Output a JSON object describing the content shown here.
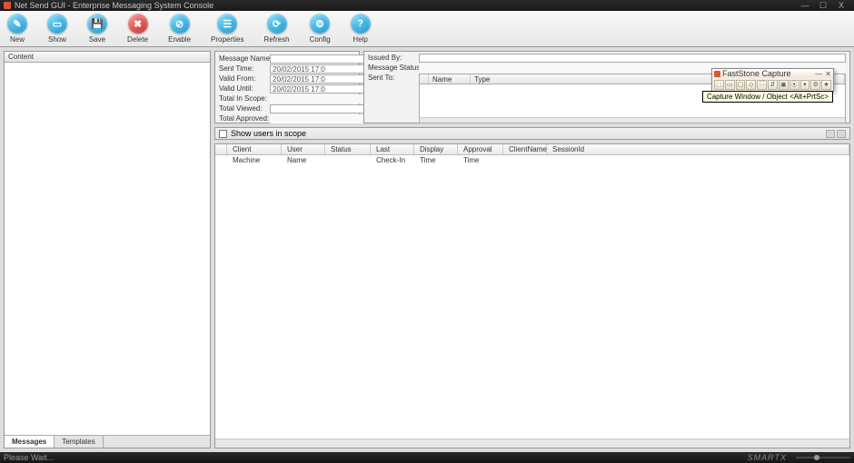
{
  "window": {
    "title": "Net Send GUI - Enterprise Messaging System Console",
    "min": "—",
    "max": "☐",
    "close": "X"
  },
  "toolbar": {
    "new": "New",
    "show": "Show",
    "save": "Save",
    "delete": "Delete",
    "enable": "Enable",
    "props": "Properties",
    "refresh": "Refresh",
    "config": "Config",
    "help": "Help"
  },
  "left": {
    "header": "Content",
    "tabs": {
      "messages": "Messages",
      "templates": "Templates"
    }
  },
  "form": {
    "message_name_lbl": "Message Name:",
    "message_name_val": "",
    "sent_time_lbl": "Sent Time:",
    "sent_time_val": "20/02/2015 17:0",
    "valid_from_lbl": "Valid From:",
    "valid_from_val": "20/02/2015 17:0",
    "valid_until_lbl": "Valid Until:",
    "valid_until_val": "20/02/2015 17:0",
    "total_scope_lbl": "Total In Scope:",
    "total_scope_val": "",
    "total_viewed_lbl": "Total Viewed:",
    "total_viewed_val": "",
    "total_approved_lbl": "Total Approved:",
    "total_approved_val": "",
    "issued_by_lbl": "Issued By:",
    "issued_by_val": "",
    "message_status_lbl": "Message Status:",
    "message_status_val": "",
    "sent_to_lbl": "Sent To:",
    "sent_to_cols": {
      "name": "Name",
      "type": "Type"
    }
  },
  "scope": {
    "show_users": "Show users in scope"
  },
  "users_grid": {
    "cols": {
      "client_machine": "Client Machine",
      "user_name": "User Name",
      "status": "Status",
      "last_checkin": "Last Check-In",
      "display_time": "Display Time",
      "approval_time": "Approval Time",
      "client_name": "ClientName",
      "session_id": "SessionId"
    }
  },
  "statusbar": {
    "text": "Please Wait...",
    "brand": "SMARTX"
  },
  "faststone": {
    "title": "FastStone Capture",
    "tooltip": "Capture Window / Object <Alt+PrtSc>"
  }
}
